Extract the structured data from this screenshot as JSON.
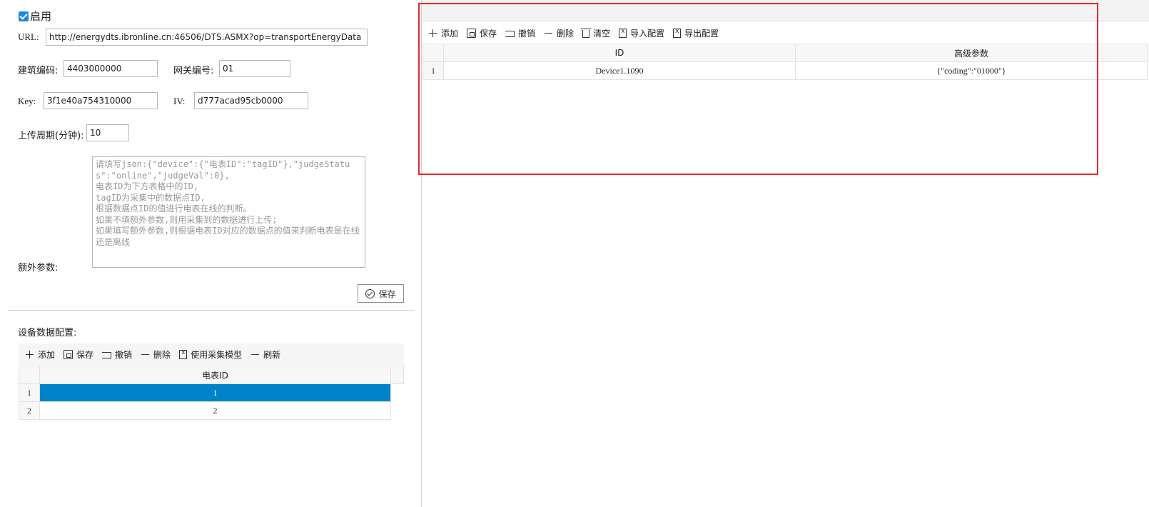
{
  "form": {
    "enable_label": "启用",
    "url_label": "URL:",
    "url_value": "http://energydts.ibronline.cn:46506/DTS.ASMX?op=transportEnergyData",
    "building_code_label": "建筑编码:",
    "building_code_value": "4403000000",
    "gateway_label": "网关编号:",
    "gateway_value": "01",
    "key_label": "Key:",
    "key_value": "3f1e40a754310000",
    "iv_label": "IV:",
    "iv_value": "d777acad95cb0000",
    "period_label": "上传周期(分钟):",
    "period_value": "10",
    "extra_label": "额外参数:",
    "extra_placeholder": "请填写json:{\"device\":{\"电表ID\":\"tagID\"},\"judgeStatus\":\"online\",\"judgeVal\":0},\n电表ID为下方表格中的ID,\ntagID为采集中的数据点ID,\n根据数据点ID的值进行电表在线的判断。\n如果不填额外参数,则用采集到的数据进行上传;\n如果填写额外参数,则根据电表ID对应的数据点的值来判断电表是在线还是离线",
    "save_label": "保存"
  },
  "device_config": {
    "title": "设备数据配置:",
    "toolbar": {
      "add": "添加",
      "save": "保存",
      "undo": "撤销",
      "delete": "删除",
      "use_model": "使用采集模型",
      "refresh": "刷新"
    },
    "column_header": "电表ID",
    "rows": [
      {
        "index": "1",
        "value": "1"
      },
      {
        "index": "2",
        "value": "2"
      }
    ]
  },
  "right_panel": {
    "toolbar": {
      "add": "添加",
      "save": "保存",
      "undo": "撤销",
      "delete": "删除",
      "clear": "清空",
      "import": "导入配置",
      "export": "导出配置"
    },
    "columns": [
      "ID",
      "高级参数"
    ],
    "rows": [
      {
        "index": "1",
        "id": "Device1.1090",
        "params": "{\"coding\":\"01000\"}"
      }
    ]
  },
  "colors": {
    "accent": "#0083c9",
    "highlight_box": "#e8262b",
    "checkbox": "#1e88e5"
  }
}
